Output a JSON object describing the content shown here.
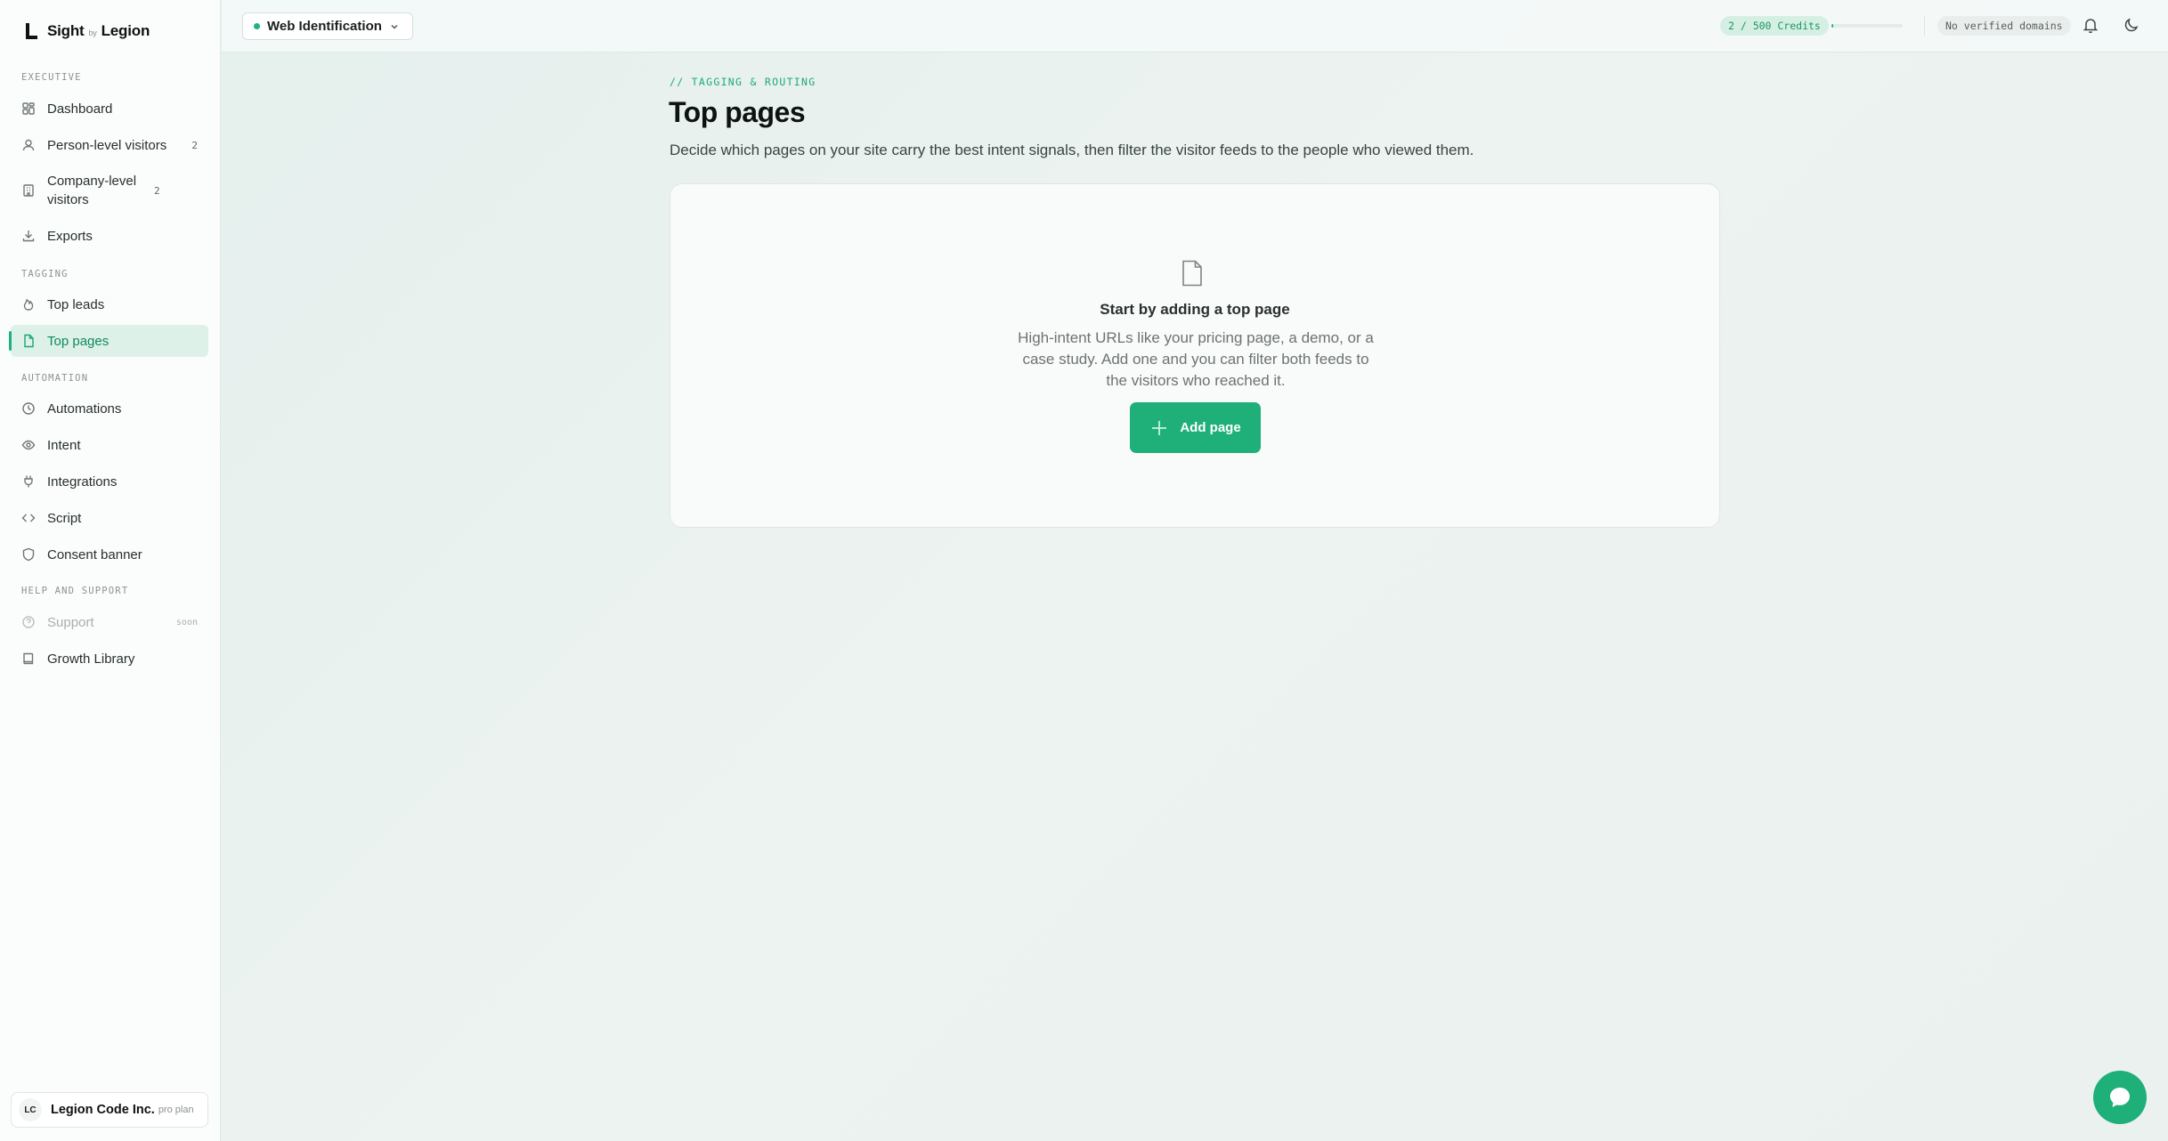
{
  "brand": {
    "name": "Sight",
    "by": "by",
    "company": "Legion"
  },
  "sidebar": {
    "sections": [
      {
        "label": "EXECUTIVE"
      },
      {
        "label": "TAGGING"
      },
      {
        "label": "AUTOMATION"
      },
      {
        "label": "HELP AND SUPPORT"
      }
    ],
    "items": [
      {
        "label": "Dashboard",
        "icon": "grid-icon"
      },
      {
        "label": "Person-level visitors",
        "icon": "user-icon",
        "count": "2"
      },
      {
        "label": "Company-level visitors",
        "icon": "building-icon",
        "count": "2"
      },
      {
        "label": "Exports",
        "icon": "download-icon"
      },
      {
        "label": "Top leads",
        "icon": "flame-icon"
      },
      {
        "label": "Top pages",
        "icon": "file-icon",
        "active": true
      },
      {
        "label": "Automations",
        "icon": "clock-icon"
      },
      {
        "label": "Intent",
        "icon": "eye-icon"
      },
      {
        "label": "Integrations",
        "icon": "plug-icon"
      },
      {
        "label": "Script",
        "icon": "code-icon"
      },
      {
        "label": "Consent banner",
        "icon": "shield-icon"
      },
      {
        "label": "Support",
        "icon": "help-circle-icon",
        "badge": "soon",
        "disabled": true
      },
      {
        "label": "Growth Library",
        "icon": "book-icon"
      }
    ],
    "account": {
      "initials": "LC",
      "name": "Legion Code Inc.",
      "plan": "pro plan"
    }
  },
  "topbar": {
    "workspace": "Web Identification",
    "credits": "2 / 500 Credits",
    "credits_used": 2,
    "credits_total": 500,
    "domains": "No verified domains",
    "accent": "#1fb07a"
  },
  "main": {
    "eyebrow": "// TAGGING & ROUTING",
    "title": "Top pages",
    "description": "Decide which pages on your site carry the best intent signals, then filter the visitor feeds to the people who viewed them.",
    "empty": {
      "title": "Start by adding a top page",
      "text": "High-intent URLs like your pricing page, a demo, or a case study. Add one and you can filter both feeds to the visitors who reached it.",
      "button": "Add page"
    }
  }
}
